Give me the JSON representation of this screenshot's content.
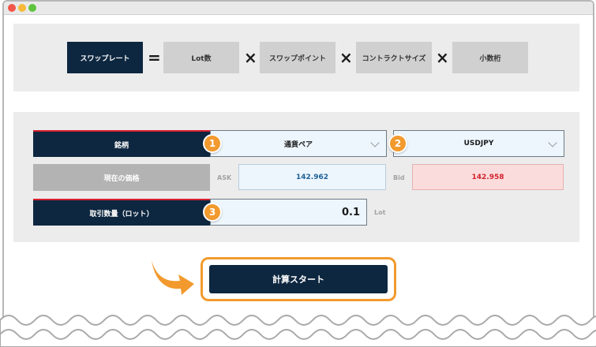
{
  "formula": {
    "result_label": "スワップレート",
    "equals": "=",
    "times": "×",
    "terms": [
      "Lot数",
      "スワップポイント",
      "コントラクトサイズ",
      "小数桁"
    ]
  },
  "calculator": {
    "symbol_row": {
      "label": "銘柄",
      "badge1": "1",
      "currency_type_value": "通貨ペア",
      "badge2": "2",
      "pair_value": "USDJPY"
    },
    "price_row": {
      "label": "現在の価格",
      "ask_label": "ASK",
      "ask_value": "142.962",
      "bid_label": "Bid",
      "bid_value": "142.958"
    },
    "lot_row": {
      "label": "取引数量（ロット）",
      "badge3": "3",
      "lot_value": "0.1",
      "unit": "Lot"
    }
  },
  "start_button": {
    "label": "計算スタート"
  },
  "colors": {
    "navy": "#0e2740",
    "accent_orange": "#f29a2e",
    "bid_red": "#d1242f",
    "ask_blue": "#1f6096"
  },
  "icons": [
    "close-dot-icon",
    "minimize-dot-icon",
    "maximize-dot-icon",
    "chevron-down-icon",
    "pointer-arrow-icon"
  ]
}
